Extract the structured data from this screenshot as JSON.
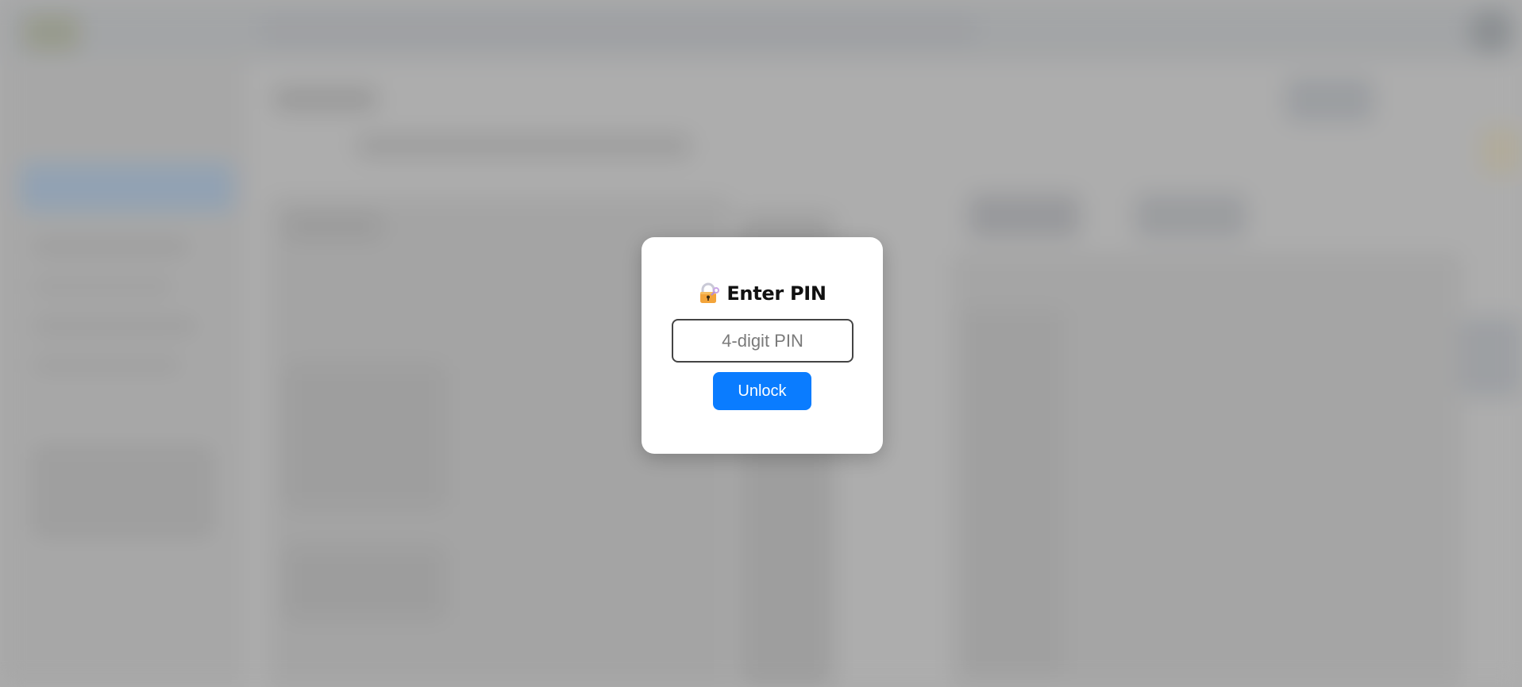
{
  "modal": {
    "icon": "lock-with-key-icon",
    "title": "Enter PIN",
    "pin_input": {
      "value": "",
      "placeholder": "4-digit PIN"
    },
    "unlock_button_label": "Unlock"
  },
  "colors": {
    "accent": "#0a7cff",
    "modal_background": "#ffffff",
    "backdrop": "#b3b3b3"
  }
}
